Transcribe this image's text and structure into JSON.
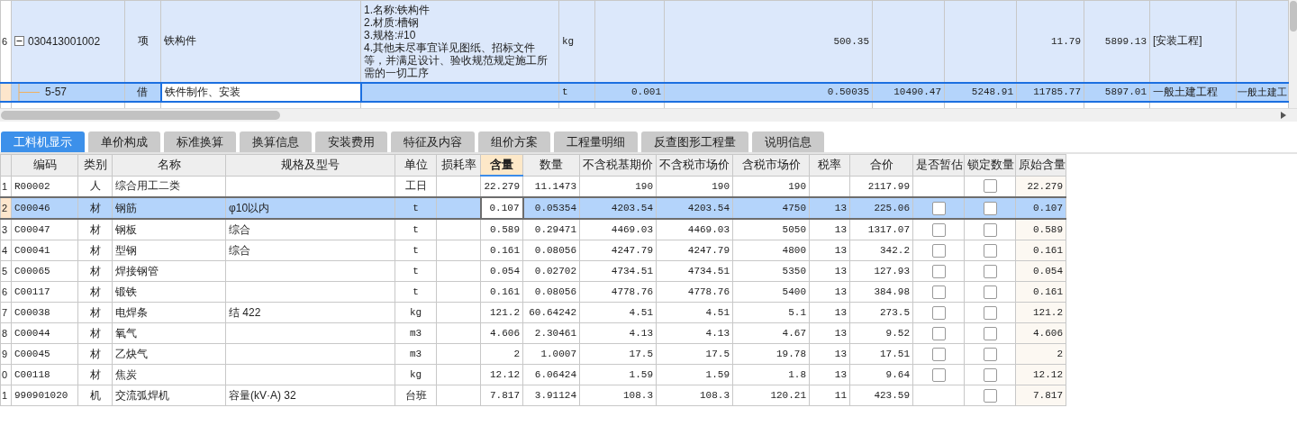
{
  "top_grid": {
    "rows": [
      {
        "index": "6",
        "expanded": true,
        "selected": false,
        "cells": [
          "030413001002",
          "项",
          "铁构件",
          [
            "1.名称:铁构件",
            "2.材质:槽钢",
            "3.规格:#10",
            "4.其他未尽事宜详见图纸、招标文件等，并满足设计、验收规范规定施工所需的一切工序"
          ],
          "kg",
          null,
          "500.35",
          null,
          null,
          "11.79",
          "5899.13",
          "[安装工程]",
          null
        ]
      },
      {
        "selected": true,
        "cells": [
          "5-57",
          "借",
          "铁件制作、安装",
          null,
          "t",
          "0.001",
          "0.50035",
          "10490.47",
          "5248.91",
          "11785.77",
          "5897.01",
          "一般土建工程",
          "一般土建工"
        ]
      }
    ]
  },
  "tabs": [
    {
      "label": "工料机显示",
      "selected": true
    },
    {
      "label": "单价构成",
      "selected": false
    },
    {
      "label": "标准换算",
      "selected": false
    },
    {
      "label": "换算信息",
      "selected": false
    },
    {
      "label": "安装费用",
      "selected": false
    },
    {
      "label": "特征及内容",
      "selected": false
    },
    {
      "label": "组价方案",
      "selected": false
    },
    {
      "label": "工程量明细",
      "selected": false
    },
    {
      "label": "反查图形工程量",
      "selected": false
    },
    {
      "label": "说明信息",
      "selected": false
    }
  ],
  "bottom_grid": {
    "columns": [
      {
        "label": "编码",
        "active": false
      },
      {
        "label": "类别",
        "active": false
      },
      {
        "label": "名称",
        "active": false
      },
      {
        "label": "规格及型号",
        "active": false
      },
      {
        "label": "单位",
        "active": false
      },
      {
        "label": "损耗率",
        "active": false
      },
      {
        "label": "含量",
        "active": true
      },
      {
        "label": "数量",
        "active": false
      },
      {
        "label": "不含税基期价",
        "active": false
      },
      {
        "label": "不含税市场价",
        "active": false
      },
      {
        "label": "含税市场价",
        "active": false
      },
      {
        "label": "税率",
        "active": false
      },
      {
        "label": "合价",
        "active": false
      },
      {
        "label": "是否暂估",
        "active": false
      },
      {
        "label": "锁定数量",
        "active": false
      },
      {
        "label": "原始含量",
        "active": false
      }
    ],
    "rows": [
      {
        "index": "1",
        "selected": false,
        "code": "R00002",
        "category": "人",
        "name": "综合用工二类",
        "unit": "工日",
        "content": "22.279",
        "quantity": "11.1473",
        "base_price": "190",
        "market_price": "190",
        "tax_market_price": "190",
        "total": "2117.99",
        "locked": false,
        "original_content": "22.279"
      },
      {
        "index": "2",
        "selected": true,
        "code": "C00046",
        "category": "材",
        "name": "钢筋",
        "spec": "φ10以内",
        "unit": "t",
        "content": "0.107",
        "quantity": "0.05354",
        "base_price": "4203.54",
        "market_price": "4203.54",
        "tax_market_price": "4750",
        "tax_rate": "13",
        "total": "225.06",
        "estimate": false,
        "locked": false,
        "original_content": "0.107"
      },
      {
        "index": "3",
        "selected": false,
        "code": "C00047",
        "category": "材",
        "name": "钢板",
        "spec": "综合",
        "unit": "t",
        "content": "0.589",
        "quantity": "0.29471",
        "base_price": "4469.03",
        "market_price": "4469.03",
        "tax_market_price": "5050",
        "tax_rate": "13",
        "total": "1317.07",
        "estimate": false,
        "locked": false,
        "original_content": "0.589"
      },
      {
        "index": "4",
        "selected": false,
        "code": "C00041",
        "category": "材",
        "name": "型钢",
        "spec": "综合",
        "unit": "t",
        "content": "0.161",
        "quantity": "0.08056",
        "base_price": "4247.79",
        "market_price": "4247.79",
        "tax_market_price": "4800",
        "tax_rate": "13",
        "total": "342.2",
        "estimate": false,
        "locked": false,
        "original_content": "0.161"
      },
      {
        "index": "5",
        "selected": false,
        "code": "C00065",
        "category": "材",
        "name": "焊接钢管",
        "unit": "t",
        "content": "0.054",
        "quantity": "0.02702",
        "base_price": "4734.51",
        "market_price": "4734.51",
        "tax_market_price": "5350",
        "tax_rate": "13",
        "total": "127.93",
        "estimate": false,
        "locked": false,
        "original_content": "0.054"
      },
      {
        "index": "6",
        "selected": false,
        "code": "C00117",
        "category": "材",
        "name": "锻铁",
        "unit": "t",
        "content": "0.161",
        "quantity": "0.08056",
        "base_price": "4778.76",
        "market_price": "4778.76",
        "tax_market_price": "5400",
        "tax_rate": "13",
        "total": "384.98",
        "estimate": false,
        "locked": false,
        "original_content": "0.161"
      },
      {
        "index": "7",
        "selected": false,
        "code": "C00038",
        "category": "材",
        "name": "电焊条",
        "spec": "结 422",
        "unit": "kg",
        "content": "121.2",
        "quantity": "60.64242",
        "base_price": "4.51",
        "market_price": "4.51",
        "tax_market_price": "5.1",
        "tax_rate": "13",
        "total": "273.5",
        "estimate": false,
        "locked": false,
        "original_content": "121.2"
      },
      {
        "index": "8",
        "selected": false,
        "code": "C00044",
        "category": "材",
        "name": "氧气",
        "unit": "m3",
        "content": "4.606",
        "quantity": "2.30461",
        "base_price": "4.13",
        "market_price": "4.13",
        "tax_market_price": "4.67",
        "tax_rate": "13",
        "total": "9.52",
        "estimate": false,
        "locked": false,
        "original_content": "4.606"
      },
      {
        "index": "9",
        "selected": false,
        "code": "C00045",
        "category": "材",
        "name": "乙炔气",
        "unit": "m3",
        "content": "2",
        "quantity": "1.0007",
        "base_price": "17.5",
        "market_price": "17.5",
        "tax_market_price": "19.78",
        "tax_rate": "13",
        "total": "17.51",
        "estimate": false,
        "locked": false,
        "original_content": "2"
      },
      {
        "index": "0",
        "selected": false,
        "code": "C00118",
        "category": "材",
        "name": "焦炭",
        "unit": "kg",
        "content": "12.12",
        "quantity": "6.06424",
        "base_price": "1.59",
        "market_price": "1.59",
        "tax_market_price": "1.8",
        "tax_rate": "13",
        "total": "9.64",
        "estimate": false,
        "locked": false,
        "original_content": "12.12"
      },
      {
        "index": "1",
        "selected": false,
        "code": "990901020",
        "category": "机",
        "name": "交流弧焊机",
        "spec": "容量(kV·A) 32",
        "unit": "台班",
        "content": "7.817",
        "quantity": "3.91124",
        "base_price": "108.3",
        "market_price": "108.3",
        "tax_market_price": "120.21",
        "tax_rate": "11",
        "total": "423.59",
        "locked": false,
        "original_content": "7.817"
      }
    ]
  }
}
